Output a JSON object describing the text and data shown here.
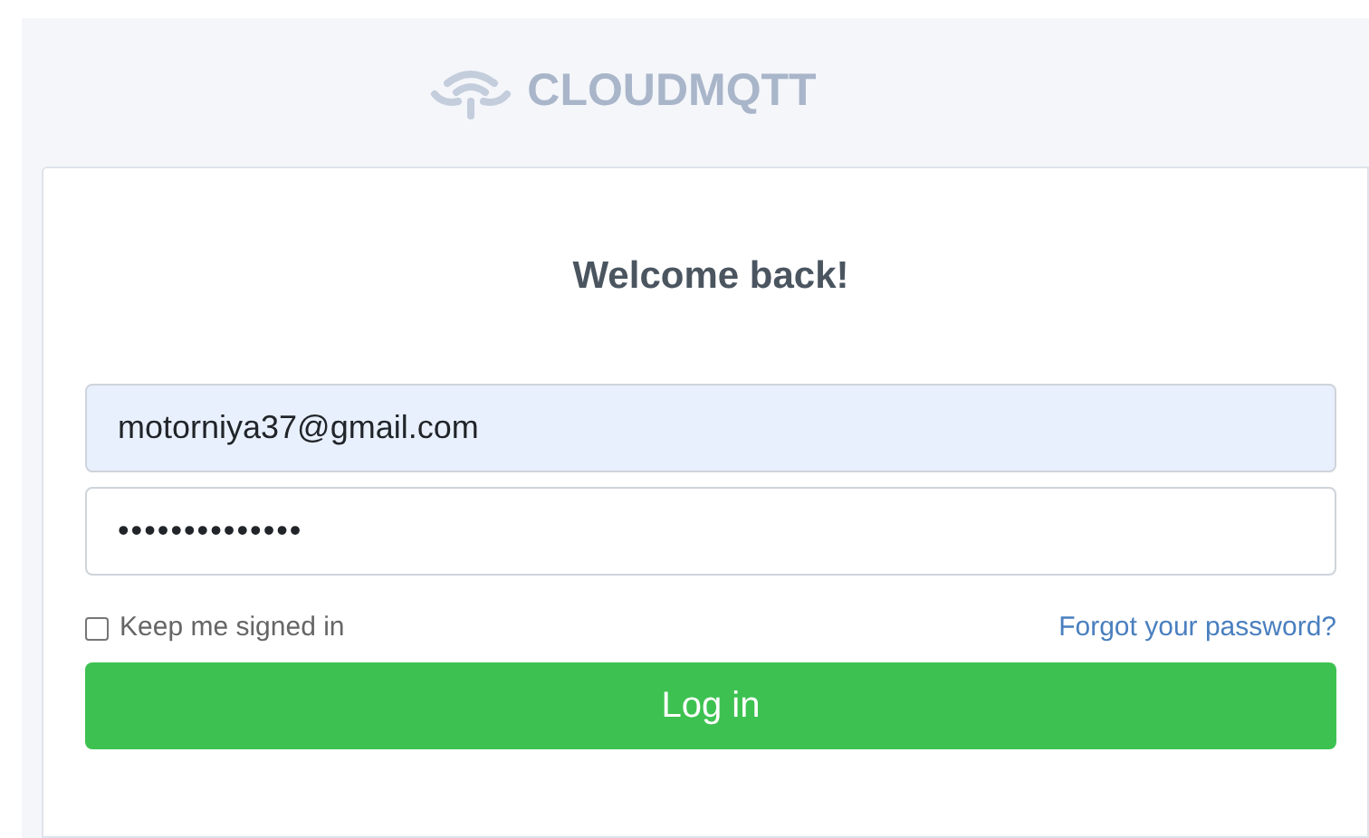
{
  "logo": {
    "text": "CLOUDMQTT"
  },
  "card": {
    "title": "Welcome back!",
    "email": {
      "value": "motorniya37@gmail.com",
      "autofilled": true
    },
    "password": {
      "value": "••••••••••••••"
    },
    "keep_signed_in": {
      "label": "Keep me signed in",
      "checked": false
    },
    "forgot_link": "Forgot your password?",
    "login_button": "Log in"
  }
}
